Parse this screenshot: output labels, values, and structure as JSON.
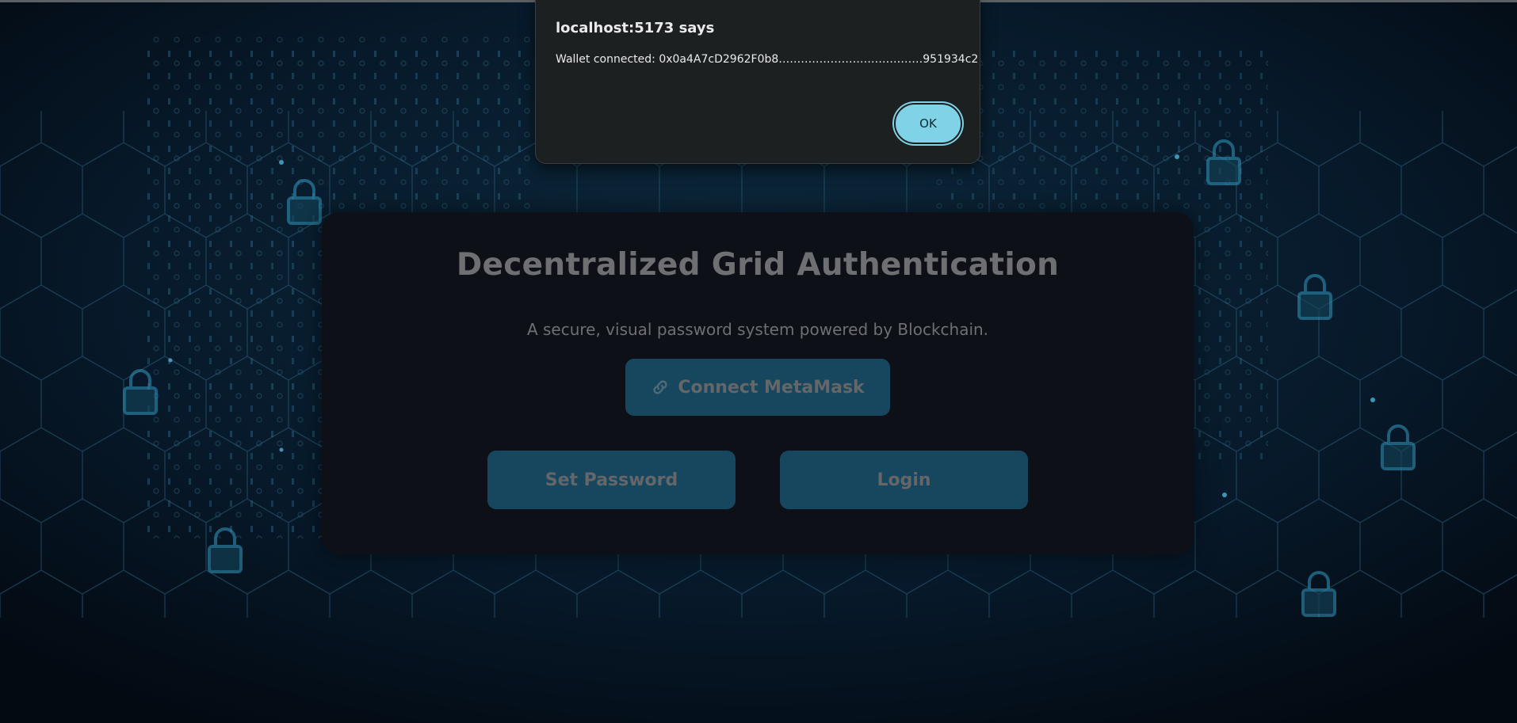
{
  "alert": {
    "title": "localhost:5173 says",
    "message": "Wallet connected: 0x0a4A7cD2962F0b8…………………………………951934c2",
    "ok_label": "OK"
  },
  "card": {
    "title": "Decentralized Grid Authentication",
    "subtitle": "A secure, visual password system powered by Blockchain.",
    "connect_label": "Connect MetaMask",
    "connect_icon": "link-icon",
    "set_password_label": "Set Password",
    "login_label": "Login"
  },
  "colors": {
    "background": "#05111c",
    "card": "#0d1117",
    "button": "#16475f",
    "ok_button": "#80d2e6",
    "dialog": "#1d2021"
  }
}
